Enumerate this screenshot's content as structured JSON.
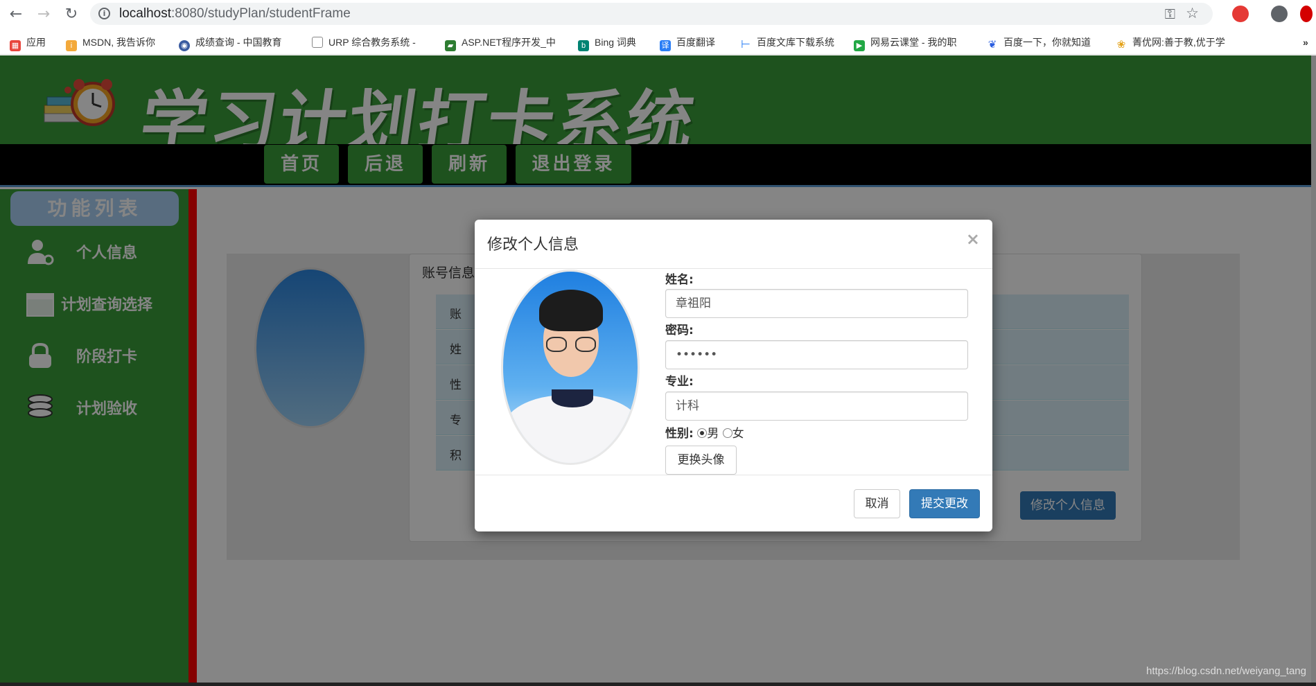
{
  "browser": {
    "url_host": "localhost",
    "url_path": ":8080/studyPlan/studentFrame",
    "bookmarks": [
      "应用",
      "MSDN, 我告诉你",
      "成绩查询 - 中国教育",
      "URP 综合教务系统 -",
      "ASP.NET程序开发_中",
      "Bing 词典",
      "百度翻译",
      "百度文库下载系统",
      "网易云课堂 - 我的职",
      "百度一下，你就知道",
      "菁优网:善于教,优于学"
    ],
    "more": "»"
  },
  "header": {
    "title": "学习计划打卡系统"
  },
  "menu": {
    "items": [
      "首页",
      "后退",
      "刷新",
      "退出登录"
    ]
  },
  "sidebar": {
    "title": "功能列表",
    "items": [
      "个人信息",
      "计划查询选择",
      "阶段打卡",
      "计划验收"
    ]
  },
  "info": {
    "heading": "账号信息",
    "rows": [
      "账",
      "姓",
      "性",
      "专",
      "积"
    ],
    "edit_button": "修改个人信息"
  },
  "modal": {
    "title": "修改个人信息",
    "close": "×",
    "name_label": "姓名:",
    "name_value": "章祖阳",
    "password_label": "密码:",
    "password_value": "••••••",
    "major_label": "专业:",
    "major_value": "计科",
    "gender_label": "性别:",
    "gender_male": "男",
    "gender_female": "女",
    "change_avatar": "更换头像",
    "cancel": "取消",
    "submit": "提交更改"
  },
  "watermark": "https://blog.csdn.net/weiyang_tang",
  "colors": {
    "brand_green": "#3a9d3a",
    "primary_blue": "#337ab7",
    "sidebar_divider": "#ff0000"
  }
}
